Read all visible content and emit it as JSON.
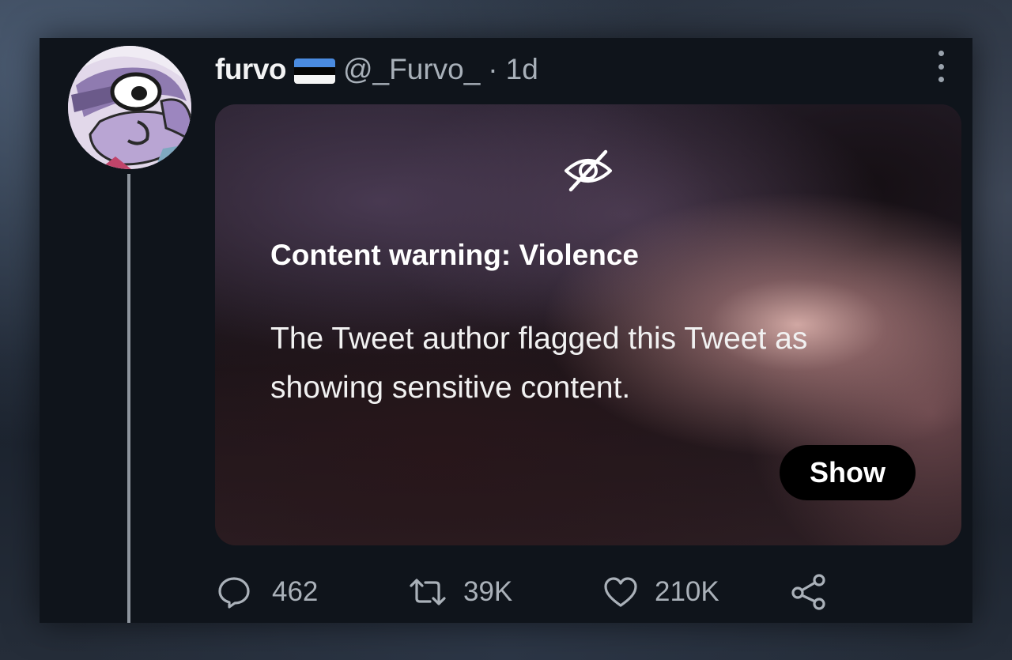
{
  "tweet": {
    "display_name": "furvo",
    "handle": "@_Furvo_",
    "separator": "·",
    "time": "1d"
  },
  "media": {
    "warning_title": "Content warning: Violence",
    "warning_body": "The Tweet author flagged this Tweet as showing sensitive content.",
    "show_label": "Show",
    "icon": "eye-slash-icon"
  },
  "actions": {
    "replies": "462",
    "retweets": "39K",
    "likes": "210K"
  },
  "colors": {
    "card_background": "#0f141b",
    "text_primary": "#f2f3f4",
    "text_secondary": "#a8b0b9",
    "show_button_background": "#000000",
    "flag_blue": "#4a8be0"
  }
}
